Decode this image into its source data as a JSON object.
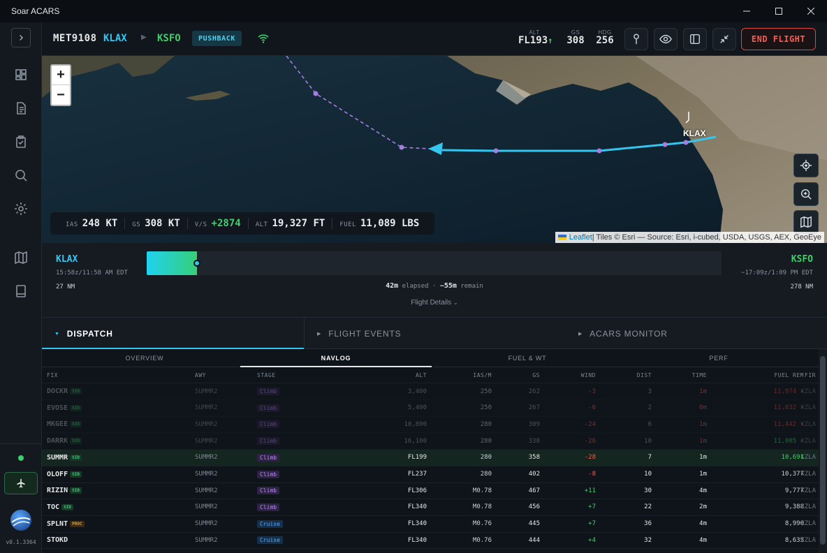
{
  "window": {
    "title": "Soar ACARS"
  },
  "sidebar": {
    "version": "v0.1.3364"
  },
  "header": {
    "callsign": "MET9108",
    "departure": "KLAX",
    "arrival": "KSFO",
    "phase": "PUSHBACK",
    "alt_label": "ALT",
    "alt_value": "FL193",
    "gs_label": "GS",
    "gs_value": "308",
    "hdg_label": "HDG",
    "hdg_value": "256",
    "end_flight": "END FLIGHT"
  },
  "map": {
    "zoom_in": "+",
    "zoom_out": "−",
    "airport_label": "KLAX",
    "attribution_link": "Leaflet",
    "attribution_text": " | Tiles © Esri — Source: Esri, i-cubed, USDA, USGS, AEX, GeoEye",
    "telemetry": [
      {
        "label": "IAS",
        "value": "248 KT",
        "color": "#e8ecf0"
      },
      {
        "label": "GS",
        "value": "308 KT",
        "color": "#e8ecf0"
      },
      {
        "label": "V/S",
        "value": "+2874",
        "color": "#3ecf6a"
      },
      {
        "label": "ALT",
        "value": "19,327 FT",
        "color": "#e8ecf0"
      },
      {
        "label": "FUEL",
        "value": "11,089 LBS",
        "color": "#e8ecf0"
      }
    ]
  },
  "progress": {
    "dep": "KLAX",
    "arr": "KSFO",
    "dep_time": "15:58z/11:58 AM EDT",
    "arr_time": "~17:09z/1:09 PM EDT",
    "dep_nm": "27 NM",
    "arr_nm": "278 NM",
    "elapsed_value": "42m",
    "elapsed_label": "elapsed",
    "sep": "·",
    "remain_value": "~55m",
    "remain_label": "remain",
    "fraction": 0.088,
    "details": "Flight Details"
  },
  "tabs": [
    "DISPATCH",
    "FLIGHT EVENTS",
    "ACARS MONITOR"
  ],
  "subtabs": [
    "OVERVIEW",
    "NAVLOG",
    "FUEL & WT",
    "PERF"
  ],
  "navlog": {
    "headers": {
      "fix": "FIX",
      "awy": "AWY",
      "stage": "STAGE",
      "alt": "ALT",
      "ias": "IAS/M",
      "gs": "GS",
      "wind": "WIND",
      "dist": "DIST",
      "time": "TIME",
      "fuel": "FUEL REM",
      "fir": "FIR"
    },
    "rows": [
      {
        "fix": "DOCKR",
        "tag": "SID",
        "awy": "SUMMR2",
        "stage": "Climb",
        "alt": "3,400",
        "ias": "250",
        "gs": "262",
        "wind": "-3",
        "dist": "3",
        "time": "1m",
        "fuel": "11,974 ▾",
        "fir": "KZLA",
        "state": "past",
        "fuelc": "red"
      },
      {
        "fix": "EVOSE",
        "tag": "SID",
        "awy": "SUMMR2",
        "stage": "Climb",
        "alt": "5,400",
        "ias": "250",
        "gs": "267",
        "wind": "-6",
        "dist": "2",
        "time": "0m",
        "fuel": "11,832 ▾",
        "fir": "KZLA",
        "state": "past",
        "fuelc": "red"
      },
      {
        "fix": "MKGEE",
        "tag": "SID",
        "awy": "SUMMR2",
        "stage": "Climb",
        "alt": "10,800",
        "ias": "280",
        "gs": "309",
        "wind": "-24",
        "dist": "6",
        "time": "1m",
        "fuel": "11,442 ▾",
        "fir": "KZLA",
        "state": "past",
        "fuelc": "red"
      },
      {
        "fix": "DARRK",
        "tag": "SID",
        "awy": "SUMMR2",
        "stage": "Climb",
        "alt": "16,100",
        "ias": "280",
        "gs": "338",
        "wind": "-26",
        "dist": "10",
        "time": "1m",
        "fuel": "11,005 ✓",
        "fir": "KZLA",
        "state": "past",
        "fuelc": "green"
      },
      {
        "fix": "SUMMR",
        "tag": "SID",
        "awy": "SUMMR2",
        "stage": "Climb",
        "alt": "FL199",
        "ias": "280",
        "gs": "358",
        "wind": "-28",
        "dist": "7",
        "time": "1m",
        "fuel": "10,691",
        "fir": "KZLA",
        "state": "cur",
        "fuelc": "green"
      },
      {
        "fix": "OLOFF",
        "tag": "SID",
        "awy": "SUMMR2",
        "stage": "Climb",
        "alt": "FL237",
        "ias": "280",
        "gs": "402",
        "wind": "-8",
        "dist": "10",
        "time": "1m",
        "fuel": "10,377",
        "fir": "KZLA",
        "state": "next",
        "fuelc": "none"
      },
      {
        "fix": "RIZIN",
        "tag": "SID",
        "awy": "SUMMR2",
        "stage": "Climb",
        "alt": "FL306",
        "ias": "M0.78",
        "gs": "467",
        "wind": "+11",
        "dist": "30",
        "time": "4m",
        "fuel": "9,777",
        "fir": "KZLA",
        "state": "next",
        "fuelc": "none"
      },
      {
        "fix": "TOC",
        "tag": "SID",
        "awy": "SUMMR2",
        "stage": "Climb",
        "alt": "FL340",
        "ias": "M0.78",
        "gs": "456",
        "wind": "+7",
        "dist": "22",
        "time": "2m",
        "fuel": "9,388",
        "fir": "KZLA",
        "state": "next",
        "fuelc": "none"
      },
      {
        "fix": "SPLNT",
        "tag": "PROC",
        "awy": "SUMMR2",
        "stage": "Cruise",
        "alt": "FL340",
        "ias": "M0.76",
        "gs": "445",
        "wind": "+7",
        "dist": "36",
        "time": "4m",
        "fuel": "8,990",
        "fir": "KZLA",
        "state": "next",
        "fuelc": "none"
      },
      {
        "fix": "STOKD",
        "tag": "",
        "awy": "SUMMR2",
        "stage": "Cruise",
        "alt": "FL340",
        "ias": "M0.76",
        "gs": "444",
        "wind": "+4",
        "dist": "32",
        "time": "4m",
        "fuel": "8,635",
        "fir": "KZLA",
        "state": "next",
        "fuelc": "none"
      }
    ]
  }
}
